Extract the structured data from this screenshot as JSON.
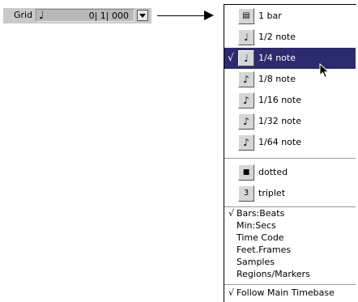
{
  "grid_control": {
    "label": "Grid",
    "note_icon": "quarter-note-icon",
    "value": "0| 1| 000"
  },
  "menu": {
    "note_items": [
      {
        "label": "1 bar",
        "icon_text": "Ⅱ",
        "icon": "bar-icon",
        "checked": false,
        "selected": false
      },
      {
        "label": "1/2 note",
        "icon_text": "𝅗𝅥",
        "icon": "half-note-icon",
        "checked": false,
        "selected": false
      },
      {
        "label": "1/4 note",
        "icon_text": "♩",
        "icon": "quarter-note-icon",
        "checked": true,
        "selected": true
      },
      {
        "label": "1/8 note",
        "icon_text": "♪",
        "icon": "eighth-note-icon",
        "checked": false,
        "selected": false
      },
      {
        "label": "1/16 note",
        "icon_text": "♬",
        "icon": "sixteenth-note-icon",
        "checked": false,
        "selected": false
      },
      {
        "label": "1/32 note",
        "icon_text": "♬",
        "icon": "thirty-second-note-icon",
        "checked": false,
        "selected": false
      },
      {
        "label": "1/64 note",
        "icon_text": "♬",
        "icon": "sixty-fourth-note-icon",
        "checked": false,
        "selected": false
      }
    ],
    "modifier_items": [
      {
        "label": "dotted",
        "icon_text": "▪",
        "icon": "dot-icon"
      },
      {
        "label": "triplet",
        "icon_text": "3",
        "icon": "triplet-icon"
      }
    ],
    "timebase_items": [
      {
        "label": "Bars:Beats",
        "checked": true
      },
      {
        "label": "Min:Secs",
        "checked": false
      },
      {
        "label": "Time Code",
        "checked": false
      },
      {
        "label": "Feet.Frames",
        "checked": false
      },
      {
        "label": "Samples",
        "checked": false
      },
      {
        "label": "Regions/Markers",
        "checked": false
      }
    ],
    "follow_item": {
      "label": "Follow Main Timebase",
      "checked": true
    },
    "checkmark": "√"
  }
}
